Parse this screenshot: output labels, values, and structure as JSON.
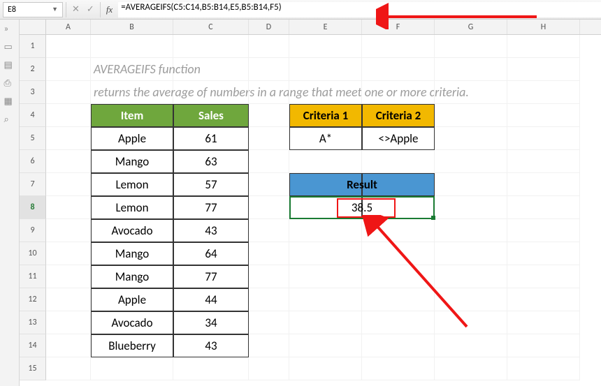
{
  "top": {
    "cell_ref": "E8",
    "formula": "=AVERAGEIFS(C5:C14,B5:B14,E5,B5:B14,F5)"
  },
  "columns": [
    "A",
    "B",
    "C",
    "D",
    "E",
    "F",
    "G",
    "H"
  ],
  "rows": [
    "1",
    "2",
    "3",
    "4",
    "5",
    "6",
    "7",
    "8",
    "9",
    "10",
    "11",
    "12",
    "13",
    "14",
    "15"
  ],
  "text": {
    "title1": "AVERAGEIFS function",
    "title2": "returns the average of numbers in a range that meet one or more criteria.",
    "item_hdr": "Item",
    "sales_hdr": "Sales",
    "crit1_hdr": "Criteria 1",
    "crit2_hdr": "Criteria 2",
    "result_hdr": "Result"
  },
  "table": {
    "items": [
      "Apple",
      "Mango",
      "Lemon",
      "Lemon",
      "Avocado",
      "Mango",
      "Mango",
      "Apple",
      "Avocado",
      "Blueberry"
    ],
    "sales": [
      "61",
      "63",
      "57",
      "77",
      "43",
      "64",
      "77",
      "44",
      "34",
      "43"
    ]
  },
  "criteria": {
    "c1": "A*",
    "c2": "<>Apple"
  },
  "result": "38.5",
  "chart_data": {
    "type": "table",
    "title": "AVERAGEIFS function",
    "columns": [
      "Item",
      "Sales"
    ],
    "rows": [
      [
        "Apple",
        61
      ],
      [
        "Mango",
        63
      ],
      [
        "Lemon",
        57
      ],
      [
        "Lemon",
        77
      ],
      [
        "Avocado",
        43
      ],
      [
        "Mango",
        64
      ],
      [
        "Mango",
        77
      ],
      [
        "Apple",
        44
      ],
      [
        "Avocado",
        34
      ],
      [
        "Blueberry",
        43
      ]
    ],
    "criteria": {
      "Criteria 1": "A*",
      "Criteria 2": "<>Apple"
    },
    "result": 38.5
  }
}
